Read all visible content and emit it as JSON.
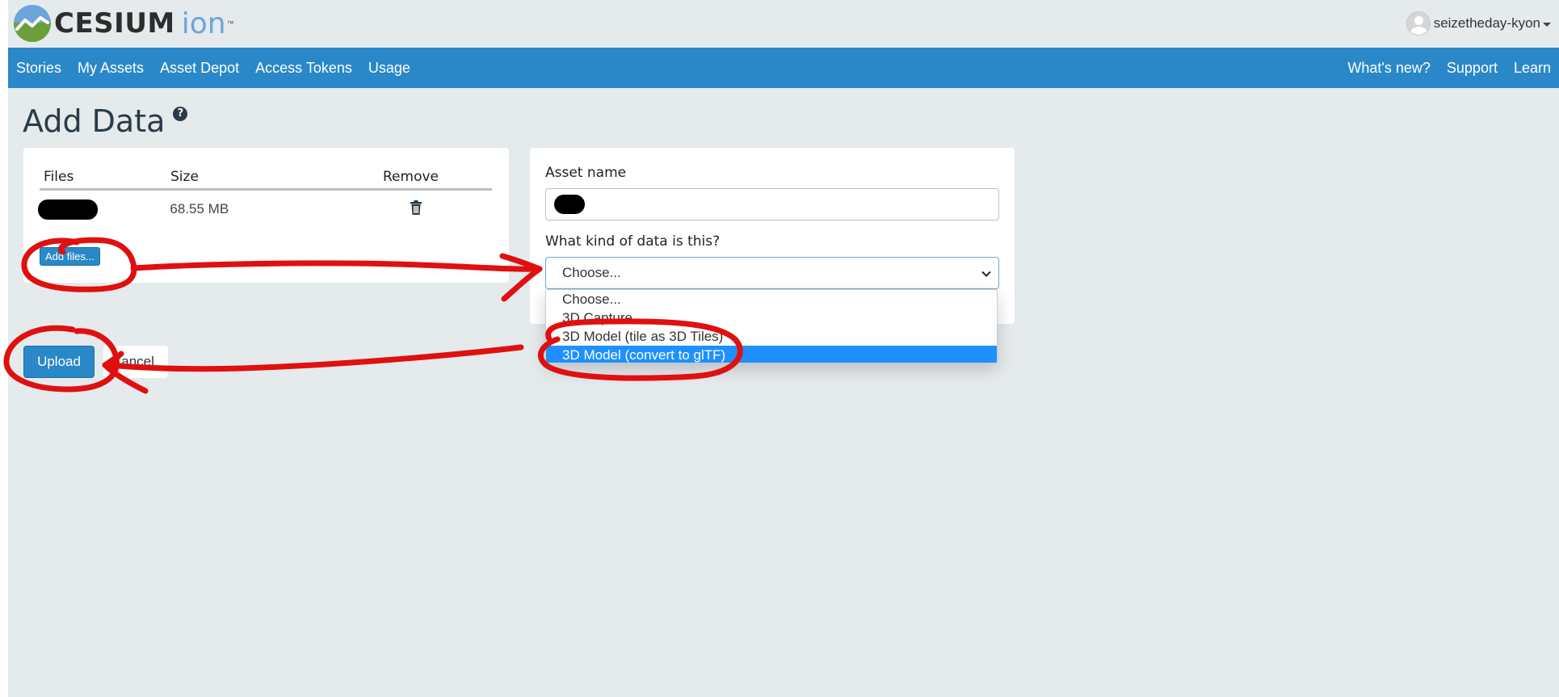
{
  "header": {
    "logo_text": "CESIUM",
    "logo_ion": "ion",
    "logo_tm": "™",
    "username": "seizetheday-kyon"
  },
  "nav": {
    "left": [
      "Stories",
      "My Assets",
      "Asset Depot",
      "Access Tokens",
      "Usage"
    ],
    "right": [
      "What's new?",
      "Support",
      "Learn"
    ]
  },
  "page": {
    "title": "Add Data",
    "help_glyph": "?"
  },
  "files": {
    "headers": {
      "files": "Files",
      "size": "Size",
      "remove": "Remove"
    },
    "rows": [
      {
        "size": "68.55 MB"
      }
    ],
    "add_files_label": "Add files..."
  },
  "asset": {
    "name_label": "Asset name",
    "kind_label": "What kind of data is this?",
    "kind_value": "Choose...",
    "options": [
      "Choose...",
      "3D Capture",
      "3D Model (tile as 3D Tiles)",
      "3D Model (convert to glTF)"
    ],
    "selected_option_index": 3
  },
  "actions": {
    "upload_label": "Upload",
    "cancel_label": "Cancel"
  },
  "colors": {
    "nav_blue": "#2a88c8",
    "page_bg": "#e5eaed",
    "selected_option": "#1e90ff",
    "annotation_red": "#e01010"
  },
  "icons": {
    "help": "question-circle-icon",
    "trash": "trash-icon",
    "chevron": "chevron-down-icon",
    "avatar": "user-avatar-icon",
    "caret": "caret-down-icon"
  }
}
